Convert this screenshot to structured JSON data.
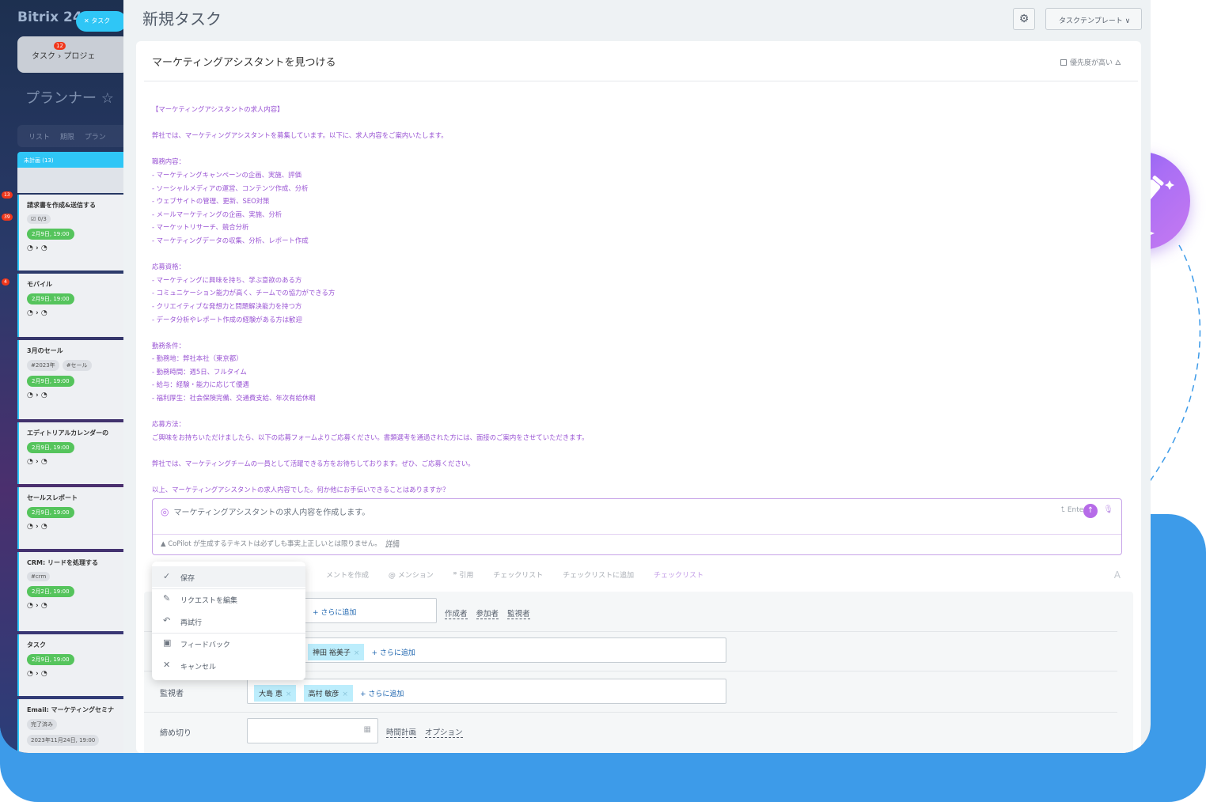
{
  "app": {
    "brand": "Bitrix 24",
    "task_pill": "タスク",
    "tasks_tab": "タスク",
    "tasks_badge": "12",
    "projects_tab": "プロジェ",
    "planner_title": "プランナー ☆",
    "view_tabs": [
      "リスト",
      "期限",
      "プラン"
    ],
    "column_title": "未計画 (13)"
  },
  "kanban_cards": [
    {
      "title": "請求書を作成&送信する",
      "tag1": "☑ 0/3",
      "date": "2月9日, 19:00",
      "avatars": "◔ › ◔"
    },
    {
      "title": "モバイル",
      "date": "2月9日, 19:00",
      "avatars": "◔ › ◔"
    },
    {
      "title": "3月のセール",
      "tag1": "#2023年",
      "tag2": "#セール",
      "date": "2月9日, 19:00",
      "avatars": "◔ › ◔"
    },
    {
      "title": "エディトリアルカレンダーの",
      "date": "2月9日, 19:00",
      "avatars": "◔ › ◔"
    },
    {
      "title": "セールスレポート",
      "date": "2月9日, 19:00",
      "avatars": "◔ › ◔"
    },
    {
      "title": "CRM: リードを処理する",
      "tag1": "#crm",
      "date": "2月2日, 19:00",
      "avatars": "◔ › ◔"
    },
    {
      "title": "タスク",
      "date": "2月9日, 19:00",
      "avatars": "◔ › ◔"
    },
    {
      "title": "Email: マーケティングセミナ",
      "tag1": "完了済み",
      "date": "2023年11月24日, 19:00",
      "avatars": ""
    }
  ],
  "side_badges": [
    "13",
    "39",
    "4"
  ],
  "header": {
    "title": "新規タスク",
    "template_button": "タスクテンプレート ∨",
    "gear": "⚙"
  },
  "task": {
    "name": "マーケティングアシスタントを見つける",
    "priority_label": "優先度が高い"
  },
  "ai_text": "【マーケティングアシスタントの求人内容】\n\n弊社では、マーケティングアシスタントを募集しています。以下に、求人内容をご案内いたします。\n\n職務内容：\n- マーケティングキャンペーンの企画、実施、評価\n- ソーシャルメディアの運営、コンテンツ作成、分析\n- ウェブサイトの管理、更新、SEO対策\n- メールマーケティングの企画、実施、分析\n- マーケットリサーチ、競合分析\n- マーケティングデータの収集、分析、レポート作成\n\n応募資格：\n- マーケティングに興味を持ち、学ぶ意欲のある方\n- コミュニケーション能力が高く、チームでの協力ができる方\n- クリエイティブな発想力と問題解決能力を持つ方\n- データ分析やレポート作成の経験がある方は歓迎\n\n勤務条件：\n- 勤務地：弊社本社（東京都）\n- 勤務時間：週5日、フルタイム\n- 給与：経験・能力に応じて優遇\n- 福利厚生：社会保険完備、交通費支給、年次有給休暇\n\n応募方法：\nご興味をお持ちいただけましたら、以下の応募フォームよりご応募ください。書類選考を通過された方には、面接のご案内をさせていただきます。\n\n弊社では、マーケティングチームの一員として活躍できる方をお待ちしております。ぜひ、ご応募ください。\n\n以上、マーケティングアシスタントの求人内容でした。何か他にお手伝いできることはありますか？",
  "copilot": {
    "input_value": "マーケティングアシスタントの求人内容を作成します。",
    "enter_hint": "⮤ Enter",
    "warning": "CoPilot が生成するテキストは必ずしも事実上正しいとは限りません。",
    "details_link": "詳細"
  },
  "toolbar": {
    "items": [
      "メントを作成",
      "@ メンション",
      "❞ 引用",
      "チェックリスト",
      "チェックリストに追加",
      "チェックリスト"
    ],
    "font_button": "A"
  },
  "menu": {
    "items": [
      "保存",
      "リクエストを編集",
      "再試行",
      "フィードバック",
      "キャンセル"
    ]
  },
  "form": {
    "add_more": "+ さらに追加",
    "roles": [
      "作成者",
      "参加者",
      "監視者"
    ],
    "assignee_chip": "神田 裕美子",
    "observers_label": "監視者",
    "observer_chips": [
      "大島 恵",
      "高村 敏彦"
    ],
    "deadline_label": "締め切り",
    "deadline_links": [
      "時間計画",
      "オプション"
    ]
  }
}
